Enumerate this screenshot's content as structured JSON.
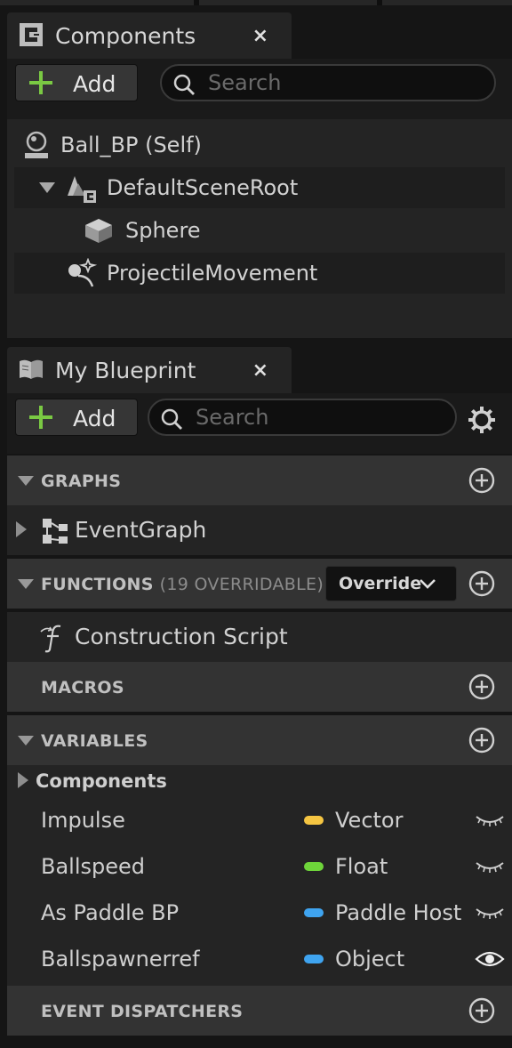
{
  "components_panel": {
    "tab_title": "Components",
    "close_glyph": "×",
    "add_label": "Add",
    "search_placeholder": "Search",
    "tree": [
      {
        "label": "Ball_BP (Self)",
        "icon": "actor-self-icon"
      },
      {
        "label": "DefaultSceneRoot",
        "icon": "scene-root-icon",
        "expanded": true
      },
      {
        "label": "Sphere",
        "icon": "static-mesh-cube-icon"
      },
      {
        "label": "ProjectileMovement",
        "icon": "projectile-movement-icon"
      }
    ]
  },
  "blueprint_panel": {
    "tab_title": "My Blueprint",
    "close_glyph": "×",
    "add_label": "Add",
    "search_placeholder": "Search",
    "sections": {
      "graphs": {
        "label": "GRAPHS",
        "items": [
          "EventGraph"
        ]
      },
      "functions": {
        "label": "FUNCTIONS",
        "sub": "(19 OVERRIDABLE)",
        "override_label": "Override",
        "items": [
          "Construction Script"
        ]
      },
      "macros": {
        "label": "MACROS"
      },
      "variables": {
        "label": "VARIABLES",
        "category": "Components",
        "items": [
          {
            "name": "Impulse",
            "type": "Vector",
            "color": "#f5c542",
            "visible": false
          },
          {
            "name": "Ballspeed",
            "type": "Float",
            "color": "#6ed43a",
            "visible": false
          },
          {
            "name": "As Paddle BP",
            "type": "Paddle Host",
            "color": "#3fa4f0",
            "visible": false
          },
          {
            "name": "Ballspawnerref",
            "type": "Object",
            "color": "#3fa4f0",
            "visible": true
          }
        ]
      },
      "event_dispatchers": {
        "label": "EVENT DISPATCHERS"
      }
    }
  },
  "colors": {
    "accent_green": "#7ac943",
    "panel_bg": "#242424",
    "section_bg": "#333333"
  }
}
